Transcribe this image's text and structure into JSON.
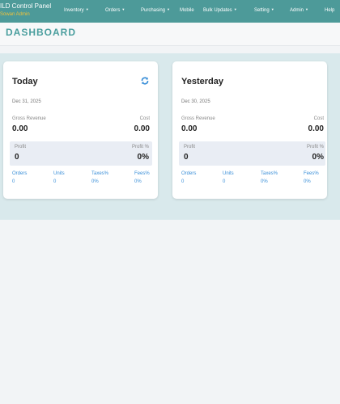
{
  "nav": {
    "brand_title": "ILD Control Panel",
    "brand_sub": "Sowan Admin",
    "items": [
      {
        "label": "Inventory",
        "dropdown": true
      },
      {
        "label": "Orders",
        "dropdown": true
      },
      {
        "label": "Purchasing",
        "dropdown": true
      },
      {
        "label": "Mobile",
        "dropdown": false
      },
      {
        "label": "Bulk Updates",
        "dropdown": true
      },
      {
        "label": "Setting",
        "dropdown": true
      },
      {
        "label": "Admin",
        "dropdown": true
      },
      {
        "label": "Help",
        "dropdown": false
      }
    ]
  },
  "page": {
    "title": "DASHBOARD"
  },
  "colors": {
    "nav_bg": "#4d9a99",
    "accent": "#4a9e9e",
    "link": "#3a8fd8",
    "brand_sub": "#f0c23b"
  },
  "cards": [
    {
      "title": "Today",
      "date": "Dec 31, 2025",
      "has_refresh": true,
      "gross_revenue_label": "Gross Revenue",
      "gross_revenue": "0.00",
      "cost_label": "Cost",
      "cost": "0.00",
      "profit_label": "Profit",
      "profit": "0",
      "profit_pct_label": "Profit %",
      "profit_pct": "0%",
      "stats": [
        {
          "label": "Orders",
          "value": "0"
        },
        {
          "label": "Units",
          "value": "0"
        },
        {
          "label": "Taxes%",
          "value": "0%"
        },
        {
          "label": "Fees%",
          "value": "0%"
        }
      ]
    },
    {
      "title": "Yesterday",
      "date": "Dec 30, 2025",
      "has_refresh": false,
      "gross_revenue_label": "Gross Revenue",
      "gross_revenue": "0.00",
      "cost_label": "Cost",
      "cost": "0.00",
      "profit_label": "Profit",
      "profit": "0",
      "profit_pct_label": "Profit %",
      "profit_pct": "0%",
      "stats": [
        {
          "label": "Orders",
          "value": "0"
        },
        {
          "label": "Units",
          "value": "0"
        },
        {
          "label": "Taxes%",
          "value": "0%"
        },
        {
          "label": "Fees%",
          "value": "0%"
        }
      ]
    }
  ]
}
